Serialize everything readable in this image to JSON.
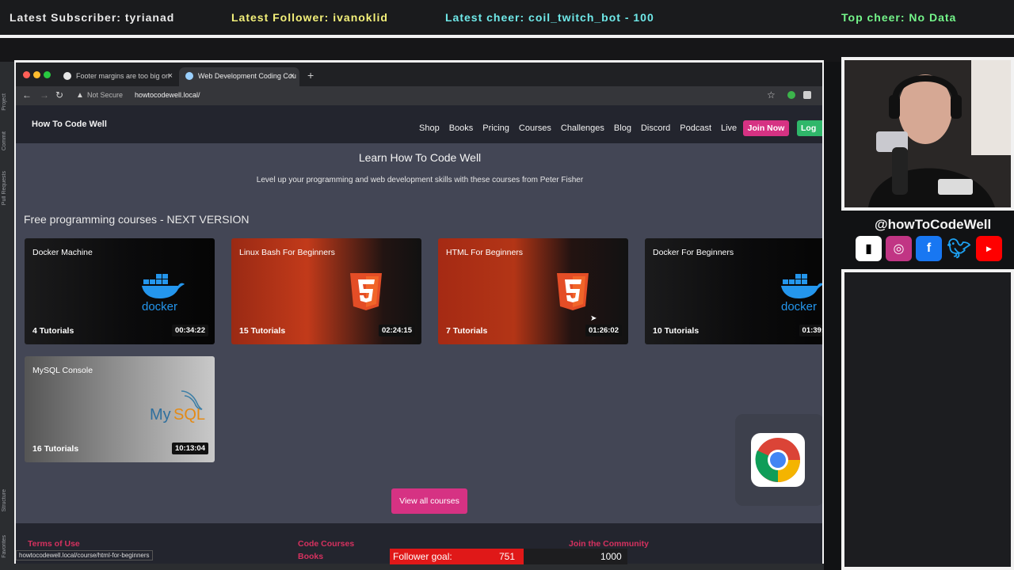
{
  "overlay": {
    "latest_subscriber": "Latest Subscriber: tyrianad",
    "latest_follower": "Latest Follower: ivanoklid",
    "latest_cheer": "Latest cheer: coil_twitch_bot - 100",
    "top_cheer": "Top cheer: No Data",
    "handle": "@howToCodeWell"
  },
  "ide": {
    "side_tabs": [
      "Project",
      "Commit",
      "Pull Requests",
      "Structure",
      "Favorites"
    ]
  },
  "browser": {
    "tabs": [
      {
        "label": "Footer margins are too big on"
      },
      {
        "label": "Web Development Coding Cou"
      }
    ],
    "security": "Not Secure",
    "url": "howtocodewell.local/"
  },
  "site": {
    "brand": "How To Code Well",
    "menu": [
      "Shop",
      "Books",
      "Pricing",
      "Courses",
      "Challenges",
      "Blog",
      "Discord",
      "Podcast",
      "Live"
    ],
    "join": "Join Now",
    "login": "Log",
    "hero_title": "Learn How To Code Well",
    "hero_sub": "Level up your programming and web development skills with these courses from Peter Fisher",
    "section_title": "Free programming courses - NEXT VERSION",
    "courses": [
      {
        "title": "Docker Machine",
        "tutorials": "4 Tutorials",
        "duration": "00:34:22"
      },
      {
        "title": "Linux Bash For Beginners",
        "tutorials": "15 Tutorials",
        "duration": "02:24:15"
      },
      {
        "title": "HTML For Beginners",
        "tutorials": "7 Tutorials",
        "duration": "01:26:02"
      },
      {
        "title": "Docker For Beginners",
        "tutorials": "10 Tutorials",
        "duration": "01:39:"
      },
      {
        "title": "MySQL Console",
        "tutorials": "16 Tutorials",
        "duration": "10:13:04"
      }
    ],
    "view_all": "View all courses",
    "footer": {
      "col1": "Terms of Use",
      "col2": "Code Courses",
      "col2_link": "Books",
      "col3": "Join the Community"
    },
    "status_url": "howtocodewell.local/course/html-for-beginners"
  },
  "goal": {
    "label": "Follower goal:",
    "current": "751",
    "target": "1000",
    "progress": 0.751
  },
  "colors": {
    "accent": "#d63283",
    "login": "#2fb76a",
    "goal": "#e01818"
  }
}
